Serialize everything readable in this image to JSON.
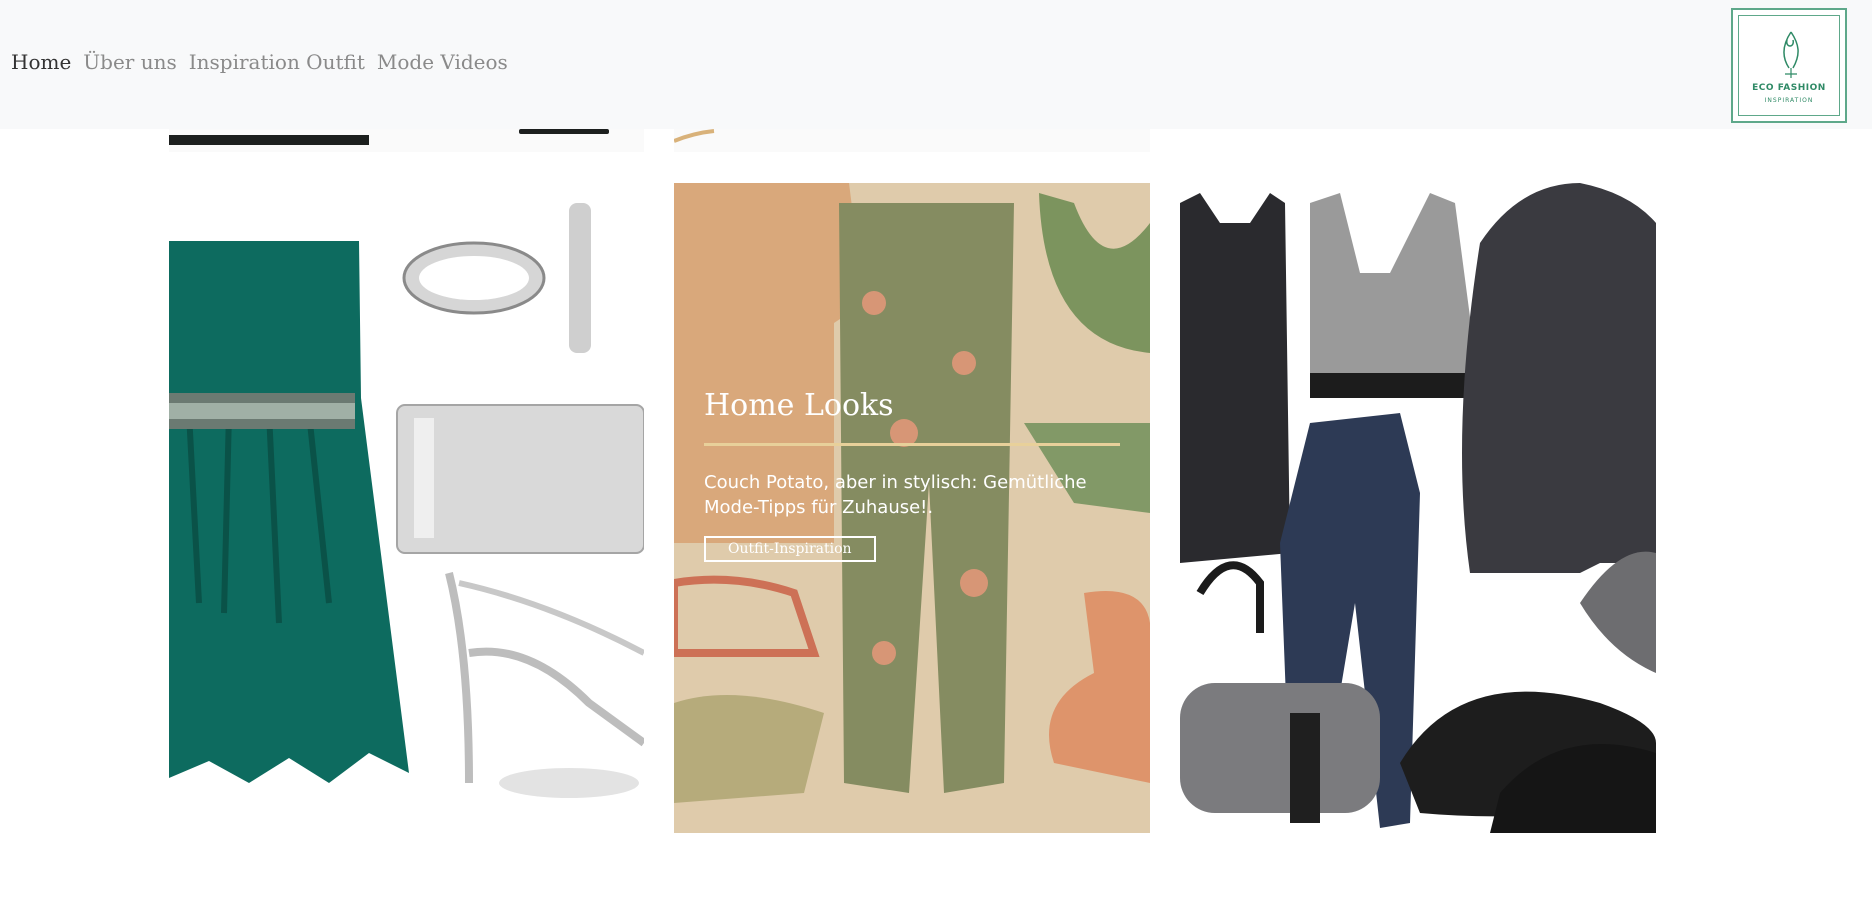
{
  "nav": {
    "items": [
      {
        "label": "Home",
        "active": true
      },
      {
        "label": "Über uns",
        "active": false
      },
      {
        "label": "Inspiration Outfit",
        "active": false
      },
      {
        "label": "Mode Videos",
        "active": false
      }
    ]
  },
  "logo": {
    "line1": "ECO FASHION",
    "line2": "INSPIRATION",
    "color": "#2f8a66"
  },
  "cards": [
    {
      "image": "evening-outfit-teal-dress-jewelry-clutch-heels"
    },
    {
      "image": "home-outfit-tshirt-floral-pants-slippers-socks",
      "title": "Home Looks",
      "text": "Couch Potato, aber in stylisch: Gemütliche Mode-Tipps für Zuhause!.",
      "button": "Outfit-Inspiration"
    },
    {
      "image": "sport-outfit-tank-nike-bra-leggings-jacket-beanie-bag-sneakers"
    }
  ],
  "colors": {
    "accent": "#e8d09a",
    "nav_bg": "#f8f9fa"
  }
}
